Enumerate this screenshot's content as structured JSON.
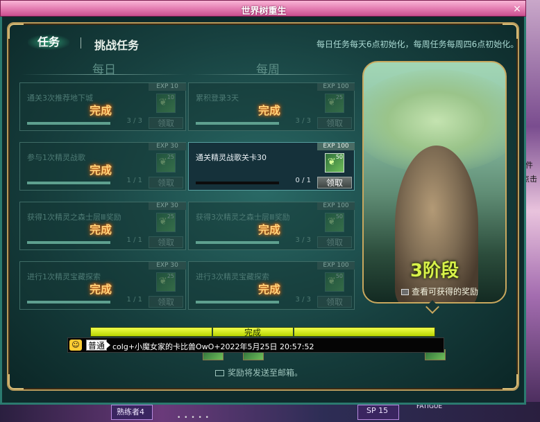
{
  "window": {
    "title": "世界树重生",
    "close_label": "×"
  },
  "tabs": {
    "active": "任务",
    "inactive": "挑战任务"
  },
  "notice": "每日任务每天6点初始化，每周任务每周四6点初始化。",
  "columns": {
    "daily": "每日",
    "weekly": "每周"
  },
  "done_label": "完成",
  "claim_label": "领取",
  "daily_tasks": [
    {
      "name": "通关3次推荐地下城",
      "progress": "3 / 3",
      "exp": "EXP 10",
      "reward_count": "10",
      "fill": 1
    },
    {
      "name": "参与1次精灵战歌",
      "progress": "1 / 1",
      "exp": "EXP 30",
      "reward_count": "25",
      "fill": 1
    },
    {
      "name": "获得1次精灵之森士层Ⅲ奖励",
      "progress": "1 / 1",
      "exp": "EXP 30",
      "reward_count": "25",
      "fill": 1
    },
    {
      "name": "进行1次精灵宝藏探索",
      "progress": "1 / 1",
      "exp": "EXP 30",
      "reward_count": "25",
      "fill": 1
    }
  ],
  "weekly_tasks": [
    {
      "name": "累积登录3天",
      "progress": "3 / 3",
      "exp": "EXP 100",
      "reward_count": "25",
      "fill": 1,
      "completed": true
    },
    {
      "name": "通关精灵战歌关卡30",
      "progress": "0 / 1",
      "exp": "EXP 100",
      "reward_count": "50",
      "fill": 0,
      "completed": false
    },
    {
      "name": "获得3次精灵之森士层Ⅲ奖励",
      "progress": "3 / 3",
      "exp": "EXP 100",
      "reward_count": "50",
      "fill": 1,
      "completed": true
    },
    {
      "name": "进行3次精灵宝藏探索",
      "progress": "3 / 3",
      "exp": "EXP 100",
      "reward_count": "50",
      "fill": 1,
      "completed": true
    }
  ],
  "tree": {
    "stage": "3阶段",
    "view_reward": "查看可获得的奖励"
  },
  "stage_bar": {
    "label": "完成",
    "fill": 1
  },
  "chat": {
    "channel": "普通",
    "message": "colg+小魔女家的卡比兽OwO+2022年5月25日 20:57:52"
  },
  "mail_notice": "奖励将发送至邮箱。",
  "side": {
    "label1": "件",
    "label2": "点击"
  },
  "bottom": {
    "name": "熟练者4",
    "sp": "SP 15",
    "fatigue": "FATIGUE"
  },
  "colors": {
    "done_glow": "#ffd27a",
    "stage_text": "#d8f24a",
    "frame_gold": "#c9a85e"
  }
}
